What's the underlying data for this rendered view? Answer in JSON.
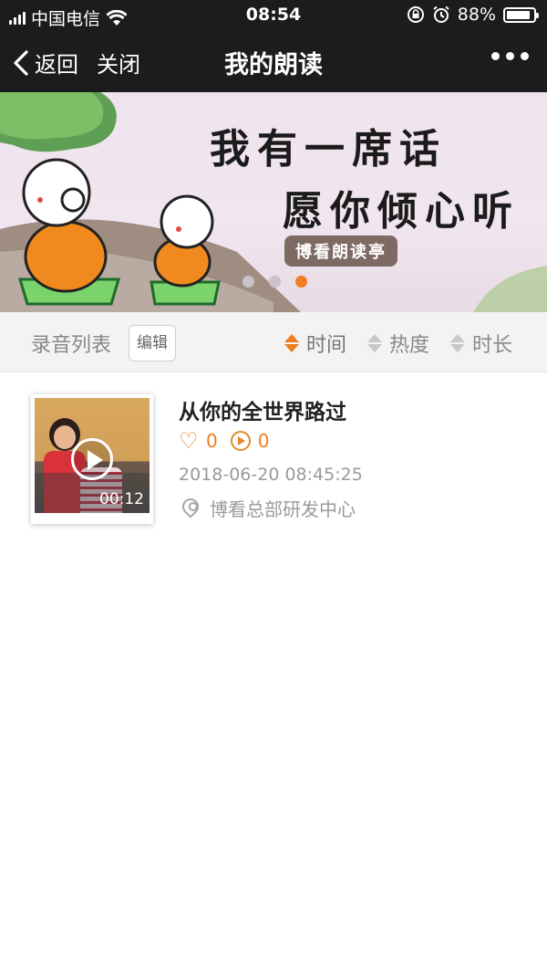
{
  "status_bar": {
    "carrier": "中国电信",
    "time": "08:54",
    "battery": "88%",
    "battery_level": 0.88
  },
  "nav": {
    "back_label": "返回",
    "close_label": "关闭",
    "title": "我的朗读",
    "more_icon": "more-dots-icon"
  },
  "banner": {
    "line1": "我有一席话",
    "line2": "愿你倾心听",
    "stamp": "博看朗读亭",
    "active_slide": 3,
    "slide_count": 3
  },
  "toolbar": {
    "title": "录音列表",
    "edit_label": "编辑",
    "sort_options": [
      "时间",
      "热度",
      "时长"
    ],
    "active_sort": "时间",
    "accent_color": "#f07d1f"
  },
  "recordings": [
    {
      "title": "从你的全世界路过",
      "likes": "0",
      "plays": "0",
      "date": "2018-06-20 08:45:25",
      "location": "博看总部研发中心",
      "duration": "00:12"
    }
  ]
}
